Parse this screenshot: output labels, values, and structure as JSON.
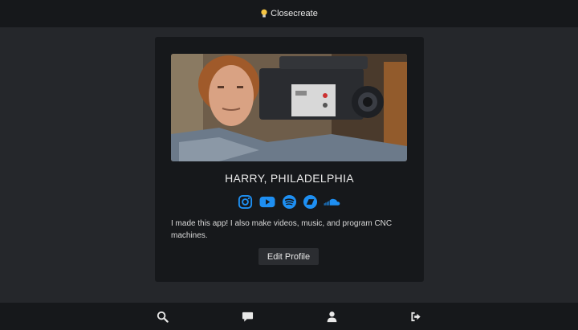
{
  "header": {
    "title": "Closecreate",
    "icon": "lightbulb-icon"
  },
  "profile": {
    "name": "HARRY, PHILADELPHIA",
    "bio": "I made this app! I also make videos, music, and program CNC machines.",
    "edit_label": "Edit Profile",
    "photo": "profile-photo"
  },
  "socials": [
    "instagram-icon",
    "youtube-icon",
    "spotify-icon",
    "bandcamp-icon",
    "soundcloud-icon"
  ],
  "nav": [
    "search-icon",
    "chat-icon",
    "user-icon",
    "logout-icon"
  ],
  "colors": {
    "accent": "#1e8ff2",
    "bar": "#16181b",
    "background": "#25272b",
    "card": "#16181b"
  }
}
